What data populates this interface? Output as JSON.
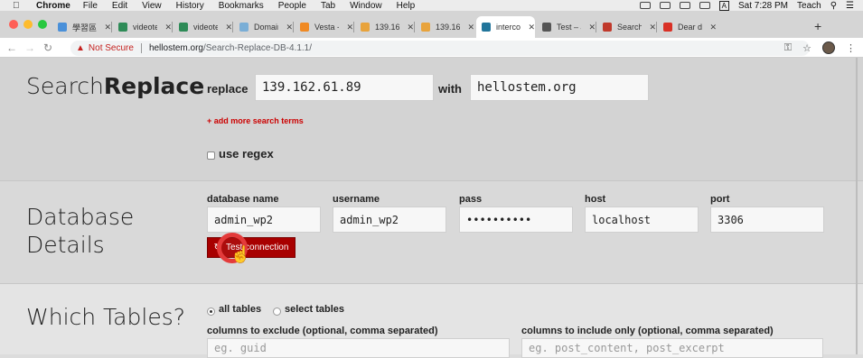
{
  "menubar": {
    "app": "Chrome",
    "items": [
      "File",
      "Edit",
      "View",
      "History",
      "Bookmarks",
      "People",
      "Tab",
      "Window",
      "Help"
    ],
    "clock": "Sat 7:28 PM",
    "user": "Teach",
    "input_source": "A"
  },
  "tabs": [
    {
      "label": "學習區",
      "color": "#4a90d9",
      "active": false
    },
    {
      "label": "videotest",
      "color": "#2e8b57",
      "active": false
    },
    {
      "label": "videotest",
      "color": "#2e8b57",
      "active": false
    },
    {
      "label": "Domain N",
      "color": "#7aaed6",
      "active": false
    },
    {
      "label": "Vesta - D",
      "color": "#f08a24",
      "active": false
    },
    {
      "label": "139.162.",
      "color": "#e8a33c",
      "active": false
    },
    {
      "label": "139.162.",
      "color": "#e8a33c",
      "active": false
    },
    {
      "label": "intercon",
      "color": "#21759b",
      "active": true
    },
    {
      "label": "Test – Ju",
      "color": "#555555",
      "active": false
    },
    {
      "label": "Search R",
      "color": "#c0392b",
      "active": false
    },
    {
      "label": "Dear ds",
      "color": "#d93025",
      "active": false
    }
  ],
  "address": {
    "security": "Not Secure",
    "host": "hellostem.org",
    "path": "/Search-Replace-DB-4.1.1/"
  },
  "search_replace": {
    "title_light": "Search",
    "title_bold": "Replace",
    "replace_label": "replace",
    "replace_value": "139.162.61.89",
    "with_label": "with",
    "with_value": "hellostem.org",
    "add_more": "+ add more search terms",
    "regex_label": "use regex"
  },
  "database": {
    "title_line1": "Database",
    "title_line2": "Details",
    "name_label": "database name",
    "name_value": "admin_wp2",
    "username_label": "username",
    "username_value": "admin_wp2",
    "pass_label": "pass",
    "pass_value": "••••••••••",
    "host_label": "host",
    "host_value": "localhost",
    "port_label": "port",
    "port_value": "3306",
    "test_button": "Test connection"
  },
  "tables": {
    "title": "Which Tables?",
    "all_label": "all tables",
    "select_label": "select tables",
    "exclude_label": "columns to exclude (optional, comma separated)",
    "exclude_placeholder": "eg. guid",
    "include_label": "columns to include only (optional, comma separated)",
    "include_placeholder": "eg. post_content, post_excerpt"
  }
}
